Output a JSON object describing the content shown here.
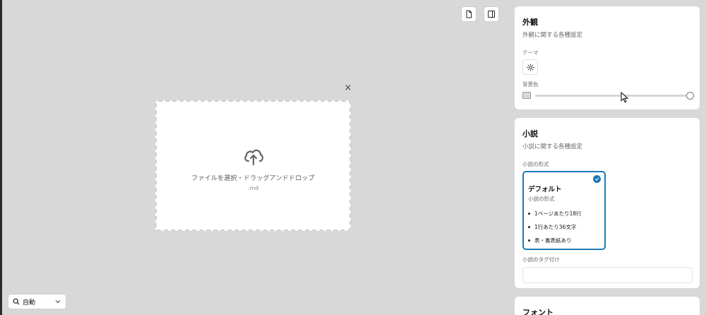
{
  "toolbar": {
    "icons": [
      "file-icon",
      "sidebar-panel-icon"
    ]
  },
  "dropzone": {
    "close_label": "×",
    "text": "ファイルを選択・ドラッグアンドドロップ",
    "ext": ".md"
  },
  "zoom": {
    "value": "自動"
  },
  "appearance": {
    "title": "外観",
    "desc": "外観に関する各種設定",
    "theme_label": "テーマ",
    "bg_label": "背景色",
    "bg_swatch_color": "#d8d8d8",
    "bg_level": 1.0
  },
  "novel": {
    "title": "小説",
    "desc": "小説に関する各種設定",
    "format_label": "小説の形式",
    "format": {
      "title": "デフォルト",
      "sub": "小説の形式",
      "items": [
        "1ページあたり18行",
        "1行あたり36文字",
        "表・裏表紙あり"
      ]
    },
    "tag_label": "小説のタグ付け",
    "tag_value": ""
  },
  "font": {
    "title": "フォント"
  },
  "colors": {
    "accent": "#1e7ab8",
    "canvas": "#d8d8d8",
    "card": "#ffffff"
  }
}
